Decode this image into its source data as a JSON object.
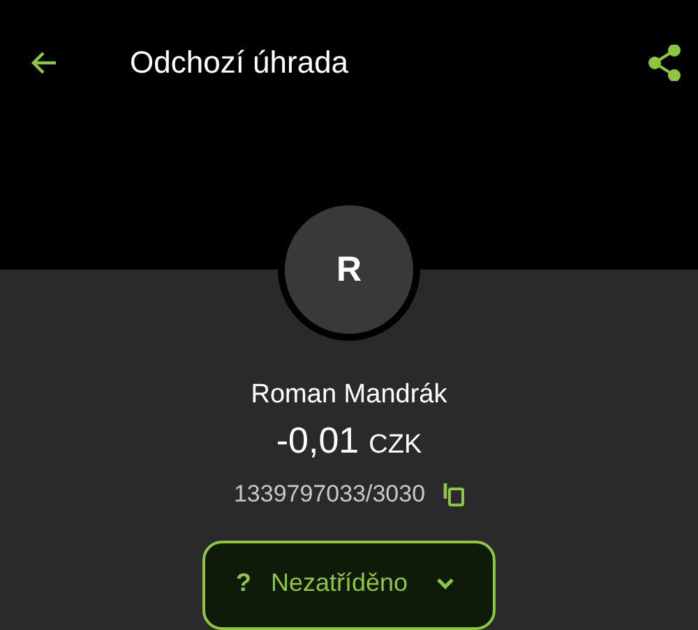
{
  "app_bar": {
    "title": "Odchozí úhrada"
  },
  "avatar": {
    "initial": "R"
  },
  "counterparty": {
    "name": "Roman Mandrák",
    "amount": "-0,01",
    "currency": "CZK",
    "account": "1339797033/3030"
  },
  "category": {
    "icon": "?",
    "label": "Nezatříděno"
  }
}
